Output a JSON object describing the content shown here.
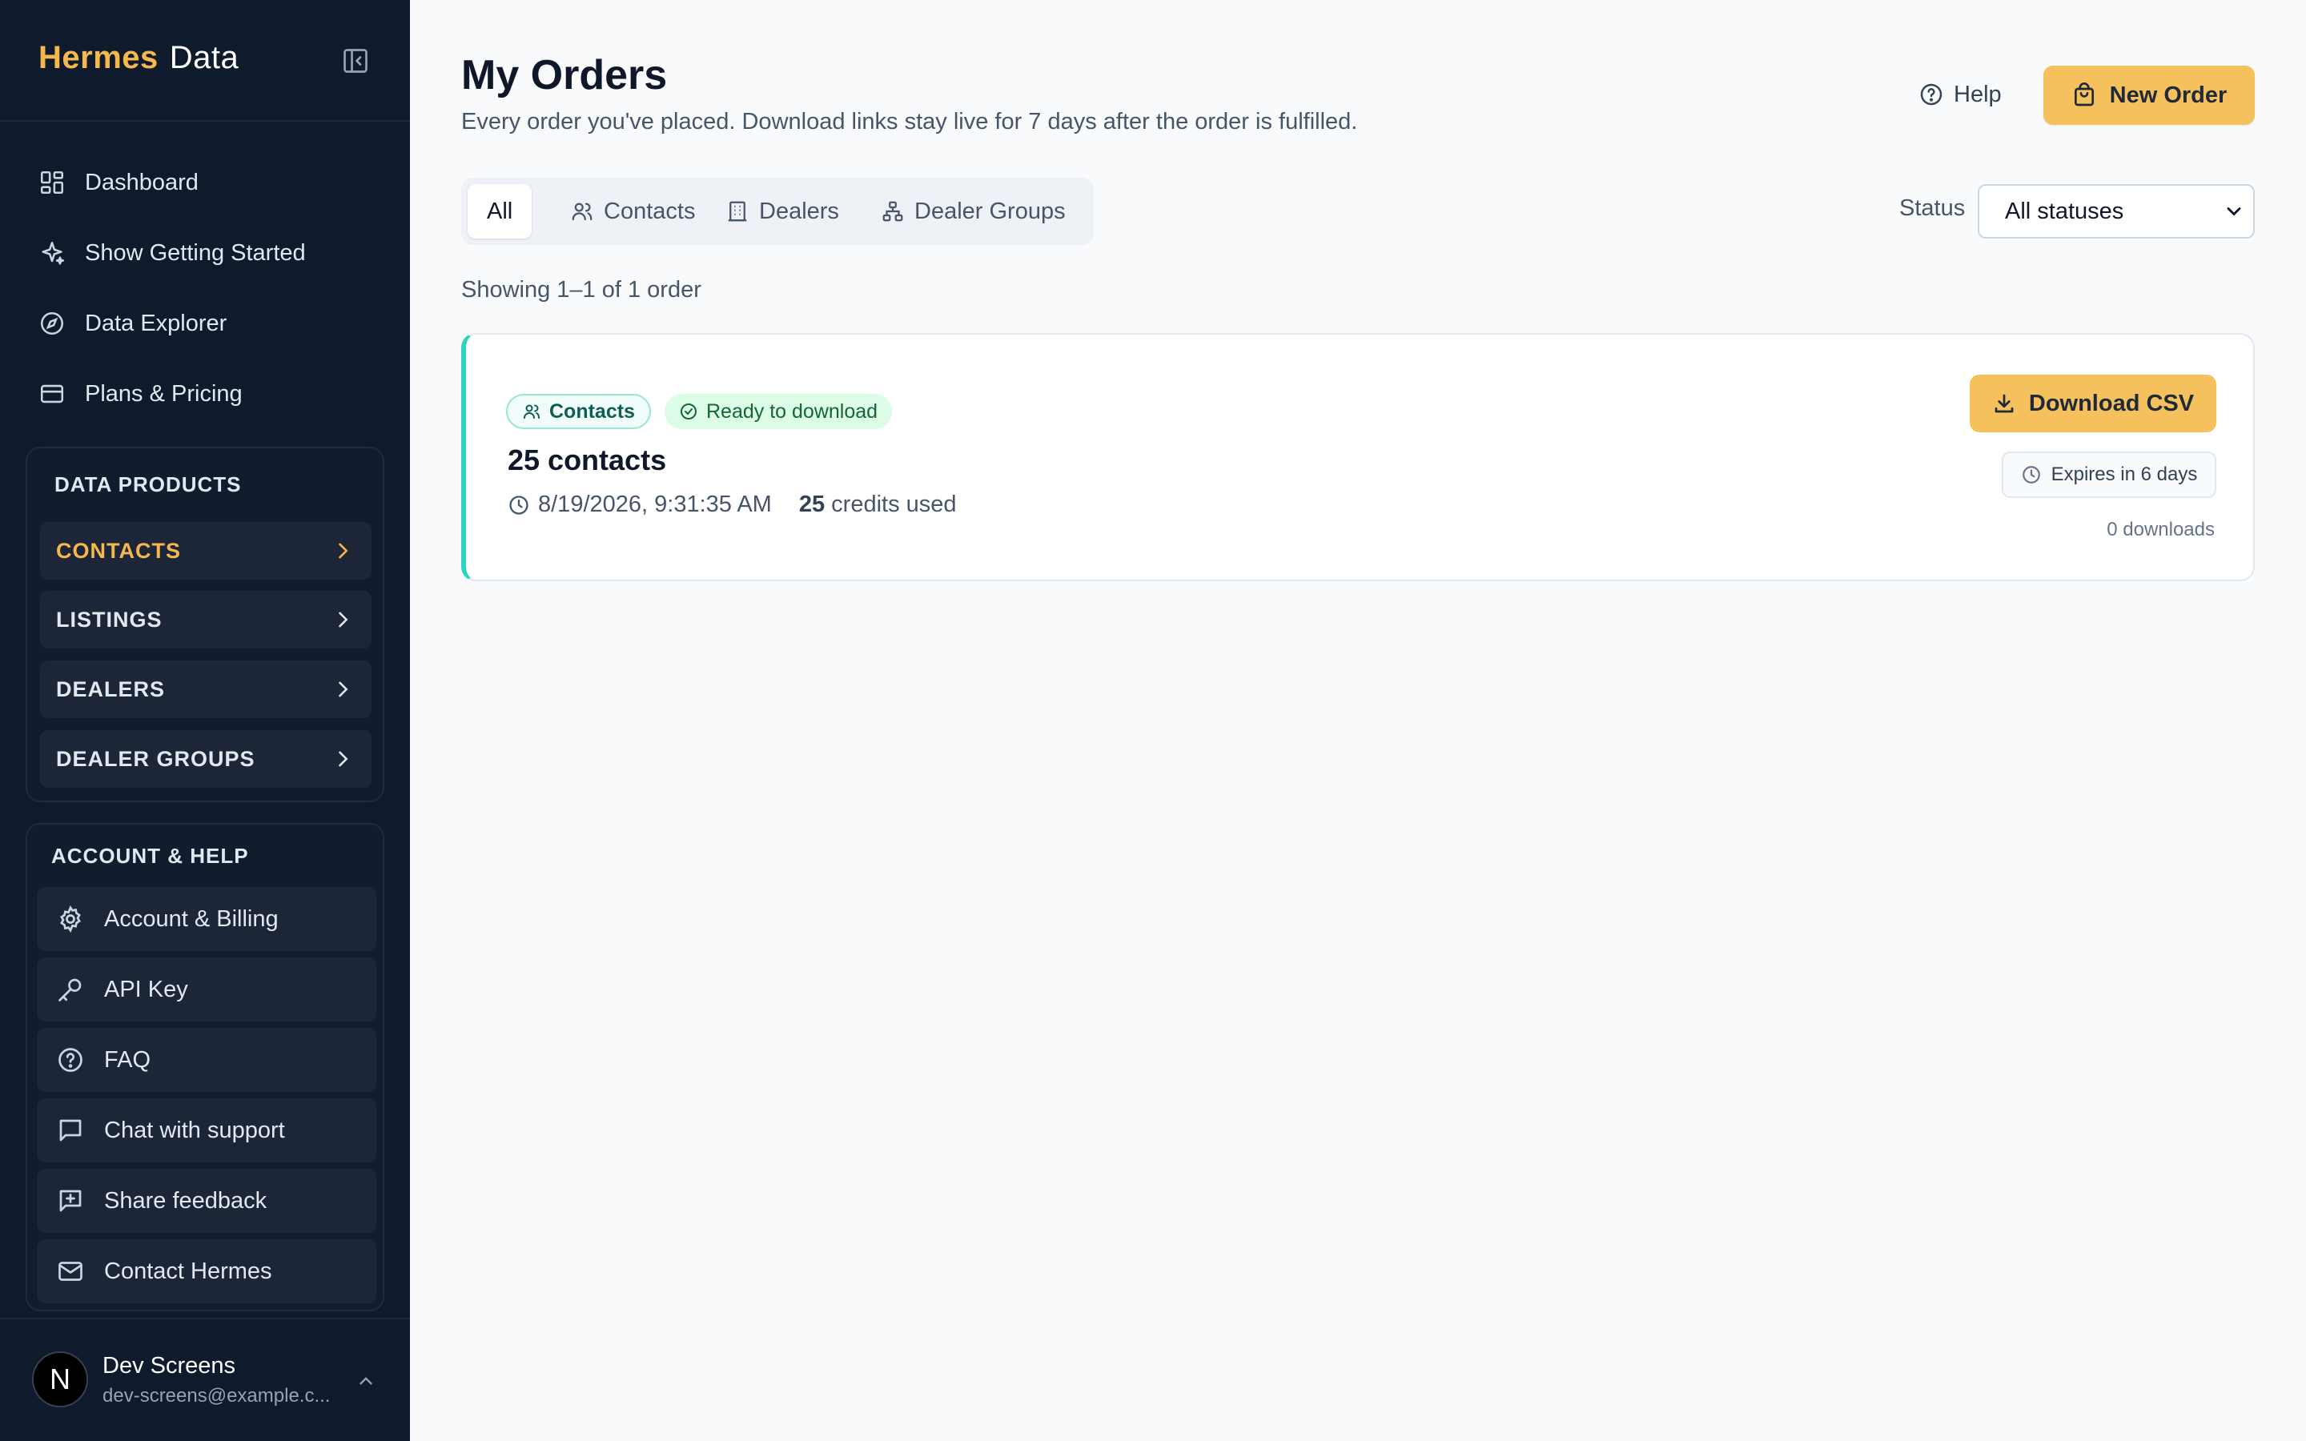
{
  "brand": {
    "part1": "Hermes",
    "part2": "Data"
  },
  "nav": [
    {
      "label": "Dashboard",
      "icon": "dashboard-icon"
    },
    {
      "label": "Show Getting Started",
      "icon": "sparkle-icon"
    },
    {
      "label": "Data Explorer",
      "icon": "compass-icon"
    },
    {
      "label": "Plans & Pricing",
      "icon": "credit-card-icon"
    }
  ],
  "data_products": {
    "title": "DATA PRODUCTS",
    "items": [
      {
        "label": "CONTACTS",
        "active": true
      },
      {
        "label": "LISTINGS",
        "active": false
      },
      {
        "label": "DEALERS",
        "active": false
      },
      {
        "label": "DEALER GROUPS",
        "active": false
      }
    ]
  },
  "account_help": {
    "title": "ACCOUNT & HELP",
    "items": [
      {
        "label": "Account & Billing",
        "icon": "gear-icon"
      },
      {
        "label": "API Key",
        "icon": "key-icon"
      },
      {
        "label": "FAQ",
        "icon": "question-icon"
      },
      {
        "label": "Chat with support",
        "icon": "chat-icon"
      },
      {
        "label": "Share feedback",
        "icon": "feedback-icon"
      },
      {
        "label": "Contact Hermes",
        "icon": "mail-icon"
      }
    ]
  },
  "user": {
    "initial": "N",
    "name": "Dev Screens",
    "email": "dev-screens@example.c..."
  },
  "header": {
    "title": "My Orders",
    "subtitle": "Every order you've placed. Download links stay live for 7 days after the order is fulfilled.",
    "help_label": "Help",
    "new_order_label": "New Order"
  },
  "tabs": [
    {
      "label": "All",
      "active": true
    },
    {
      "label": "Contacts",
      "icon": "users-icon"
    },
    {
      "label": "Dealers",
      "icon": "building-icon"
    },
    {
      "label": "Dealer Groups",
      "icon": "network-icon"
    }
  ],
  "filter": {
    "label": "Status",
    "selected": "All statuses"
  },
  "showing": "Showing 1–1 of 1 order",
  "orders": [
    {
      "type": "Contacts",
      "status": "Ready to download",
      "title": "25 contacts",
      "timestamp": "8/19/2026, 9:31:35 AM",
      "credits": "25",
      "credits_suffix": "credits used",
      "download_label": "Download CSV",
      "expires": "Expires in 6 days",
      "downloads": "0 downloads"
    }
  ],
  "colors": {
    "sidebar_bg": "#0f1a2c",
    "accent": "#f5c15d",
    "brand_accent": "#f5b84d",
    "card_border_accent": "#2dd4bf"
  }
}
